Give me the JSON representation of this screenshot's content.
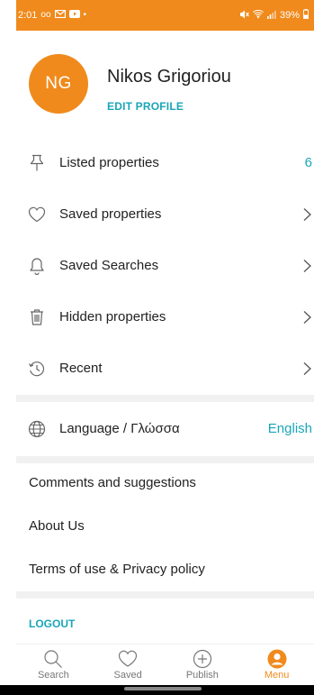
{
  "status_bar": {
    "time": "2:01",
    "battery": "39%",
    "left_icons": [
      "voicemail-icon",
      "gmail-icon",
      "youtube-icon",
      "dot-icon"
    ],
    "right_icons": [
      "mute-icon",
      "wifi-icon",
      "signal-icon",
      "battery-icon"
    ]
  },
  "profile": {
    "initials": "NG",
    "name": "Nikos Grigoriou",
    "edit_label": "EDIT PROFILE"
  },
  "menu": {
    "listed": {
      "label": "Listed properties",
      "count": "6",
      "icon": "pushpin-icon"
    },
    "saved": {
      "label": "Saved properties",
      "icon": "heart-icon"
    },
    "searches": {
      "label": "Saved Searches",
      "icon": "bell-icon"
    },
    "hidden": {
      "label": "Hidden properties",
      "icon": "trash-icon"
    },
    "recent": {
      "label": "Recent",
      "icon": "history-icon"
    },
    "language": {
      "label": "Language / Γλώσσα",
      "value": "English",
      "icon": "globe-icon"
    }
  },
  "links": {
    "comments": "Comments and suggestions",
    "about": "About Us",
    "terms": "Terms of use & Privacy policy"
  },
  "logout_label": "LOGOUT",
  "bottom_nav": {
    "search": "Search",
    "saved": "Saved",
    "publish": "Publish",
    "menu": "Menu",
    "active": "Menu"
  },
  "colors": {
    "accent": "#f08a1c",
    "link": "#1aa5b8",
    "divider": "#f1f1f1"
  }
}
